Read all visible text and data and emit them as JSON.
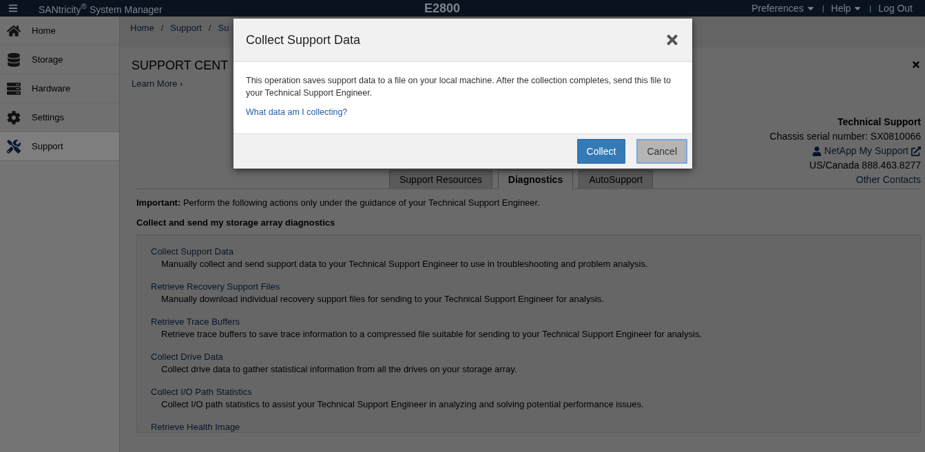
{
  "topbar": {
    "brand": "SANtricity$^{®}$ System Manager",
    "model": "E2800",
    "menus": [
      {
        "label": "Preferences",
        "dropdown": true
      },
      {
        "separator": "|",
        "label": "Help",
        "dropdown": true
      },
      {
        "separator": "|",
        "label": "Log Out",
        "dropdown": false
      }
    ]
  },
  "sidebar": {
    "items": [
      {
        "label": "Home",
        "selected": false
      },
      {
        "label": "Storage",
        "selected": false
      },
      {
        "label": "Hardware",
        "selected": false
      },
      {
        "label": "Settings",
        "selected": false
      },
      {
        "label": "Support",
        "selected": true
      }
    ]
  },
  "breadcrumb": [
    {
      "label": "Home"
    },
    {
      "separator": "/",
      "label": "Support"
    },
    {
      "separator": "/",
      "label": "Su"
    }
  ],
  "page": {
    "title": "SUPPORT CENT",
    "learn_more": "Learn More ›",
    "contacts": {
      "heading": "Technical Support",
      "serial": "Chassis serial number: SX0810066",
      "support_link": "NetApp My Support",
      "phone": "US/Canada 888.463.8277",
      "other": "Other Contacts"
    },
    "tabs": [
      {
        "label": "Support Resources",
        "selected": false
      },
      {
        "label": "Diagnostics",
        "selected": true
      },
      {
        "label": "AutoSupport",
        "selected": false
      }
    ],
    "important": "**Important:** Perform the following actions only under the guidance of your Technical Support Engineer.",
    "section_title": "Collect and send my storage array diagnostics",
    "actions": [
      {
        "title": "Collect Support Data",
        "description": "Manually collect and send support data to your Technical Support Engineer to use in troubleshooting and problem analysis."
      },
      {
        "title": "Retrieve Recovery Support Files",
        "description": "Manually download individual recovery support files for sending to your Technical Support Engineer for analysis."
      },
      {
        "title": "Retrieve Trace Buffers",
        "description": "Retrieve trace buffers to save trace information to a compressed file suitable for sending to your Technical Support Engineer for analysis."
      },
      {
        "title": "Collect Drive Data",
        "description": "Collect drive data to gather statistical information from all the drives on your storage array."
      },
      {
        "title": "Collect I/O Path Statistics",
        "description": "Collect I/O path statistics to assist your Technical Support Engineer in analyzing and solving potential performance issues."
      },
      {
        "title": "Retrieve Health Image"
      }
    ]
  },
  "dialog": {
    "title": "Collect Support Data",
    "message": "This operation saves support data to a file on your local machine. After the collection completes, send this file to your Technical Support Engineer.",
    "link": "What data am I collecting?",
    "buttons": [
      {
        "label": "Collect",
        "kind": "primary"
      },
      {
        "label": "Cancel",
        "kind": "secondary"
      }
    ]
  }
}
